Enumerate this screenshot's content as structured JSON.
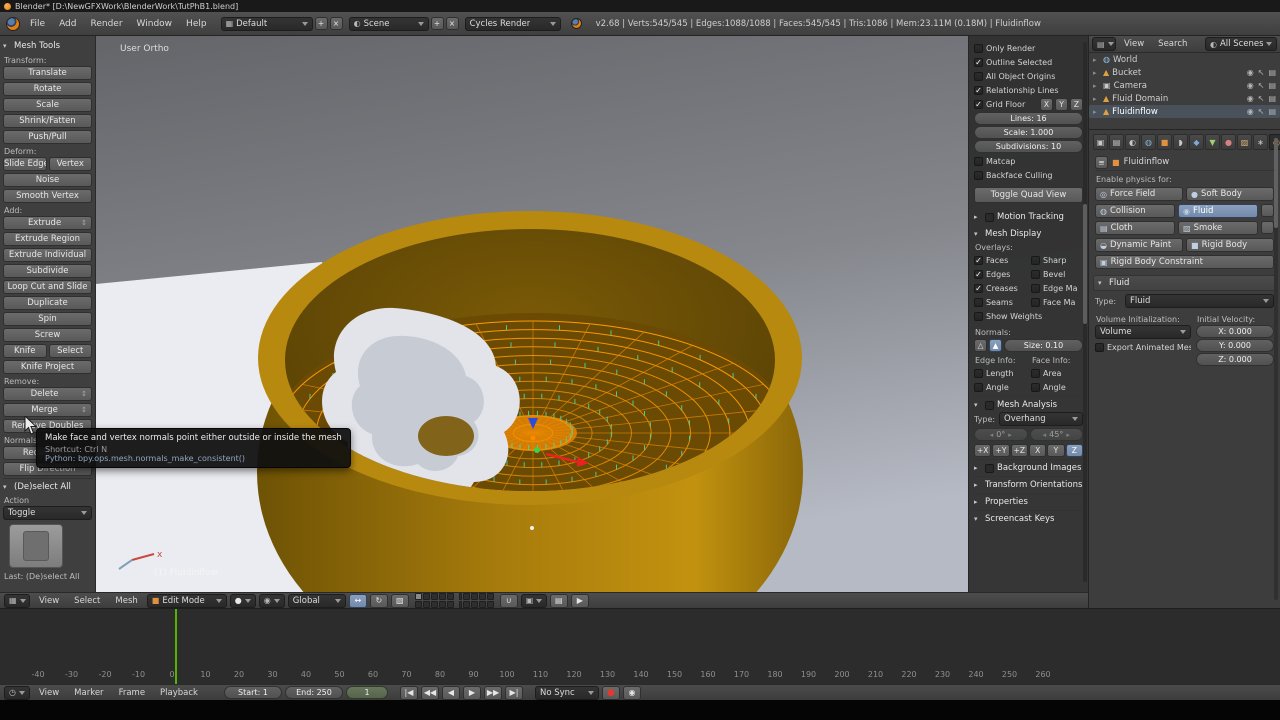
{
  "window": {
    "title": "Blender* [D:\\NewGFXWork\\BlenderWork\\TutPhB1.blend]"
  },
  "info_bar": {
    "menus": [
      "File",
      "Add",
      "Render",
      "Window",
      "Help"
    ],
    "layout": "Default",
    "scene": "Scene",
    "engine": "Cycles Render",
    "stats": "v2.68 | Verts:545/545 | Edges:1088/1088 | Faces:545/545 | Tris:1086 | Mem:23.11M (0.18M) | Fluidinflow"
  },
  "tool_shelf": {
    "title": "Mesh Tools",
    "groups": [
      {
        "label": "Transform:",
        "buttons": [
          "Translate",
          "Rotate",
          "Scale",
          "Shrink/Fatten",
          "Push/Pull"
        ]
      },
      {
        "label": "Deform:",
        "buttons": [
          "Slide Edge",
          "Vertex",
          "Noise",
          "Smooth Vertex"
        ]
      },
      {
        "label": "Add:",
        "buttons": [
          "Extrude",
          "Extrude Region",
          "Extrude Individual",
          "Subdivide",
          "Loop Cut and Slide",
          "Duplicate",
          "Spin",
          "Screw",
          "Knife",
          "Select",
          "Knife Project"
        ]
      },
      {
        "label": "Remove:",
        "buttons": [
          "Delete",
          "Merge",
          "Remove Doubles"
        ]
      },
      {
        "label": "Normals:",
        "buttons": [
          "Recalculate",
          "Flip Direction"
        ]
      }
    ],
    "op_title": "(De)select All",
    "op_action_label": "Action",
    "op_action_value": "Toggle",
    "op_last": "Last: (De)select All"
  },
  "tooltip": {
    "title": "Make face and vertex normals point either outside or inside the mesh",
    "shortcut": "Shortcut: Ctrl N",
    "python": "Python: bpy.ops.mesh.normals_make_consistent()"
  },
  "viewport": {
    "view_label": "User Ortho",
    "object_label": "(1) Fluidinflow"
  },
  "n_panel": {
    "only_render": "Only Render",
    "outline_selected": "Outline Selected",
    "all_object_origins": "All Object Origins",
    "relationship_lines": "Relationship Lines",
    "grid_floor": "Grid Floor",
    "axis_x": "X",
    "axis_y": "Y",
    "axis_z": "Z",
    "lines": "Lines: 16",
    "scale": "Scale: 1.000",
    "subdivisions": "Subdivisions: 10",
    "matcap": "Matcap",
    "backface_culling": "Backface Culling",
    "toggle_quad_view": "Toggle Quad View",
    "motion_tracking": "Motion Tracking",
    "mesh_display": "Mesh Display",
    "overlays_label": "Overlays:",
    "faces": "Faces",
    "sharp": "Sharp",
    "edges": "Edges",
    "bevel": "Bevel",
    "creases": "Creases",
    "edge_marks": "Edge Ma",
    "seams": "Seams",
    "face_marks": "Face Ma",
    "show_weights": "Show Weights",
    "normals_label": "Normals:",
    "normals_size": "Size: 0.10",
    "edge_info_label": "Edge Info:",
    "face_info_label": "Face Info:",
    "length": "Length",
    "area": "Area",
    "angle_edge": "Angle",
    "angle_face": "Angle",
    "mesh_analysis": "Mesh Analysis",
    "type_label": "Type:",
    "analysis_type": "Overhang",
    "deg_min": "0°",
    "deg_max": "45°",
    "axis_buttons": [
      "+X",
      "+Y",
      "+Z",
      "X",
      "Y",
      "Z"
    ],
    "background_images": "Background Images",
    "transform_orientations": "Transform Orientations",
    "properties": "Properties",
    "screencast_keys": "Screencast Keys"
  },
  "outliner": {
    "menu_view": "View",
    "menu_search": "Search",
    "display_mode": "All Scenes",
    "items": [
      "World",
      "Bucket",
      "Camera",
      "Fluid Domain",
      "Fluidinflow"
    ]
  },
  "properties": {
    "context_name": "Fluidinflow",
    "enable_label": "Enable physics for:",
    "buttons": [
      "Force Field",
      "Soft Body",
      "Collision",
      "Fluid",
      "Cloth",
      "Smoke",
      "Dynamic Paint",
      "Rigid Body",
      "Rigid Body Constraint"
    ],
    "fluid_panel": "Fluid",
    "type_label": "Type:",
    "type_value": "Fluid",
    "volume_init_label": "Volume Initialization:",
    "volume_value": "Volume",
    "export_mesh": "Export Animated Mesh",
    "init_velocity_label": "Initial Velocity:",
    "vel_x": "X: 0.000",
    "vel_y": "Y: 0.000",
    "vel_z": "Z: 0.000"
  },
  "view_header": {
    "menus": [
      "View",
      "Select",
      "Mesh"
    ],
    "mode": "Edit Mode",
    "orientation": "Global"
  },
  "timeline": {
    "menus": [
      "View",
      "Marker",
      "Frame",
      "Playback"
    ],
    "start": "Start: 1",
    "end": "End: 250",
    "current": "1",
    "playback": [
      "|◀",
      "◀◀",
      "◀",
      "▶",
      "▶▶",
      "▶|"
    ],
    "sync": "No Sync",
    "ruler_frames": [
      -40,
      -30,
      -20,
      -10,
      0,
      10,
      20,
      30,
      40,
      50,
      60,
      70,
      80,
      90,
      100,
      110,
      120,
      130,
      140,
      150,
      160,
      170,
      180,
      190,
      200,
      210,
      220,
      230,
      240,
      250,
      260
    ],
    "current_frame": 1
  },
  "icons": {
    "updown": "↕",
    "viewport_editor": "▦",
    "timeline_editor": "◷",
    "outliner_editor": "▤",
    "screen_db": "▦",
    "scene_db": "◐",
    "add": "+",
    "close": "×",
    "mode_cube": "■",
    "shading_sphere": "●",
    "pivot": "◉",
    "manipulators": [
      "↔",
      "↻",
      "▧"
    ],
    "magnet": "∪",
    "snap_element": "▣",
    "render_still": "▤",
    "render_anim": "▶",
    "eye": "◉",
    "select_arrow": "↖",
    "render_restrict": "▤",
    "tabs": [
      "▣",
      "▤",
      "◐",
      "◍",
      "■",
      "◗",
      "◆",
      "▼",
      "●",
      "▨",
      "∗",
      "◎"
    ],
    "physics": [
      "◎",
      "●",
      "◍",
      "◉",
      "▤",
      "▨",
      "◒",
      "■",
      "▣"
    ],
    "outliner_items": [
      "◍",
      "▲",
      "▣",
      "▲",
      "▲"
    ],
    "normals_vertex": "△",
    "normals_face": "▲",
    "breadcrumb_list": "≡",
    "record": "●"
  },
  "colors": {
    "accent_orange": "#e87d0d",
    "mesh_wire": "#ff9b00",
    "normals_teal": "#49d8a6",
    "cup_gold": "#a87c0c",
    "frame_green": "#53b500"
  }
}
